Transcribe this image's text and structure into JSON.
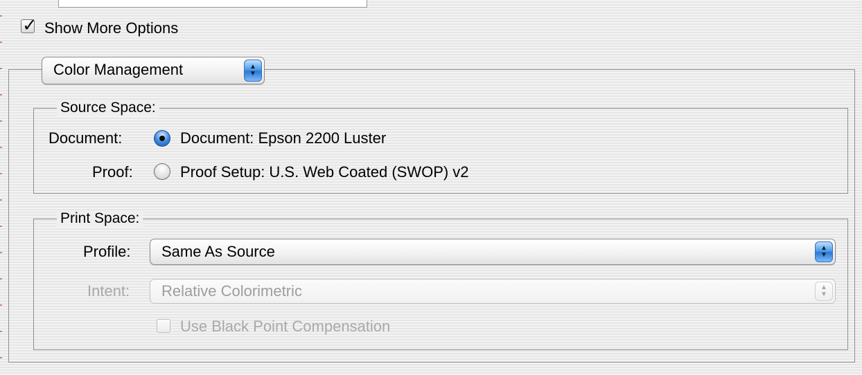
{
  "show_more_options": {
    "label": "Show More Options",
    "checked": true
  },
  "section_popup": {
    "value": "Color Management"
  },
  "source_space": {
    "title": "Source Space:",
    "document_label": "Document:",
    "document_option": "Document:  Epson 2200 Luster",
    "document_selected": true,
    "proof_label": "Proof:",
    "proof_option": "Proof Setup:  U.S. Web Coated (SWOP) v2",
    "proof_selected": false
  },
  "print_space": {
    "title": "Print Space:",
    "profile_label": "Profile:",
    "profile_value": "Same As Source",
    "intent_label": "Intent:",
    "intent_value": "Relative Colorimetric",
    "intent_enabled": false,
    "bpc_label": "Use Black Point Compensation",
    "bpc_checked": false,
    "bpc_enabled": false
  },
  "icons": {
    "checkmark": "checkmark-icon",
    "popup_arrows": "up-down-arrows-icon",
    "radio": "radio-dot-icon"
  },
  "colors": {
    "accent": "#3a86dc",
    "disabled_text": "#a9a9a9"
  }
}
